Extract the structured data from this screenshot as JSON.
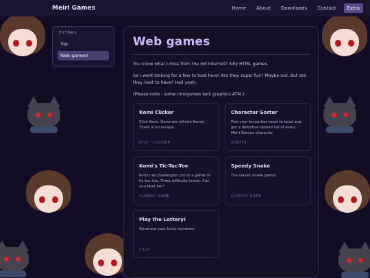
{
  "nav": {
    "brand": "Meiri Games",
    "links": [
      "Home",
      "About",
      "Downloads",
      "Contact"
    ],
    "active_link": "Extra"
  },
  "sidebar": {
    "heading": "EXTRAS",
    "items": [
      {
        "label": "Top",
        "active": false
      },
      {
        "label": "Web games!",
        "active": true
      }
    ]
  },
  "main": {
    "title": "Web games",
    "paragraphs": [
      "You know what I miss from the old internet? Silly HTML games.",
      "So I went looking for a few to host here! Are they super fun? Maybe not. But are they neat to have? Hell yeah.",
      "(Please note - some minigames lack graphics ATM.)"
    ],
    "cards": [
      {
        "title": "Komi Clicker",
        "desc": "Click Komi. Generate infinite Komis. There is no escape.",
        "tag": "IDLE · CLICKER"
      },
      {
        "title": "Character Sorter",
        "desc": "Pick your favourites head to head and get a definitive ranked list of every Meiri Games character.",
        "tag": "SORTER"
      },
      {
        "title": "Komi's Tic-Tac-Toe",
        "desc": "Komi has challenged you to a game of tic-tac-toe. Three difficulty levels. Can you beat her?",
        "tag": "CLASSIC GAME"
      },
      {
        "title": "Speedy Snake",
        "desc": "The classic snake game!",
        "tag": "CLASSIC GAME"
      },
      {
        "title": "Play the Lottery!",
        "desc": "Generate your lucky numbers.",
        "tag": "SILLY"
      }
    ]
  },
  "colors": {
    "background": "#120c24",
    "accent": "#5b4b8c",
    "title": "#cdb9f5",
    "tag": "#7f74b3"
  }
}
